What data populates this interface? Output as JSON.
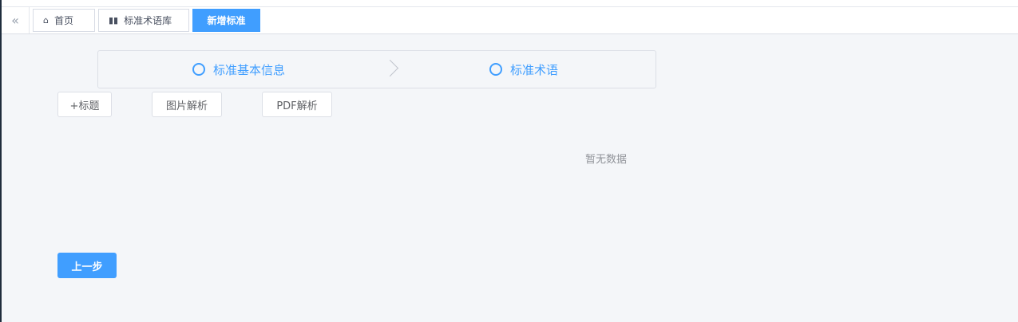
{
  "tabs": {
    "home": "首页",
    "library": "标准术语库",
    "new": "新增标准"
  },
  "icons": {
    "collapse": "double-chevron-left-icon",
    "home": "home-icon",
    "library": "book-icon"
  },
  "steps": [
    {
      "label": "标准基本信息"
    },
    {
      "label": "标准术语"
    }
  ],
  "toolbar": {
    "add_title": "+标题",
    "image_parse": "图片解析",
    "pdf_parse": "PDF解析"
  },
  "empty_text": "暂无数据",
  "footer": {
    "prev_label": "上一步"
  },
  "colors": {
    "primary": "#409eff",
    "background": "#f4f6f9"
  }
}
